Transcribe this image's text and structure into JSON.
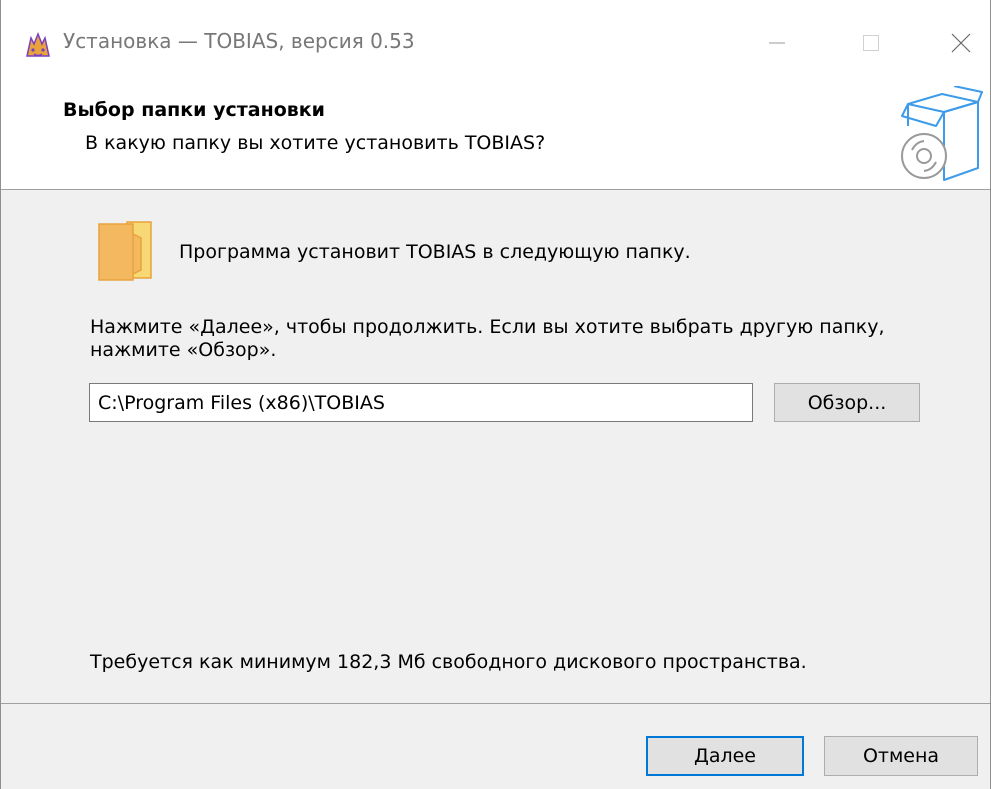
{
  "window": {
    "title": "Установка — TOBIAS, версия 0.53",
    "app_icon": "tobias-app-icon"
  },
  "header": {
    "title": "Выбор папки установки",
    "subtitle": "В какую папку вы хотите установить TOBIAS?",
    "graphic": "box-disc-icon"
  },
  "content": {
    "folder_icon": "folder-icon",
    "intro": "Программа установит TOBIAS в следующую папку.",
    "instruction": "Нажмите «Далее», чтобы продолжить. Если вы хотите выбрать другую папку, нажмите «Обзор».",
    "path_value": "C:\\Program Files (x86)\\TOBIAS",
    "browse_label": "Обзор...",
    "space_required": "Требуется как минимум 182,3 Мб свободного дискового пространства."
  },
  "footer": {
    "next_label": "Далее",
    "cancel_label": "Отмена"
  },
  "colors": {
    "accent": "#0078d7",
    "folder": "#f8d775",
    "folder_outline": "#e8a33d",
    "graphic_stroke": "#3d9be9"
  }
}
